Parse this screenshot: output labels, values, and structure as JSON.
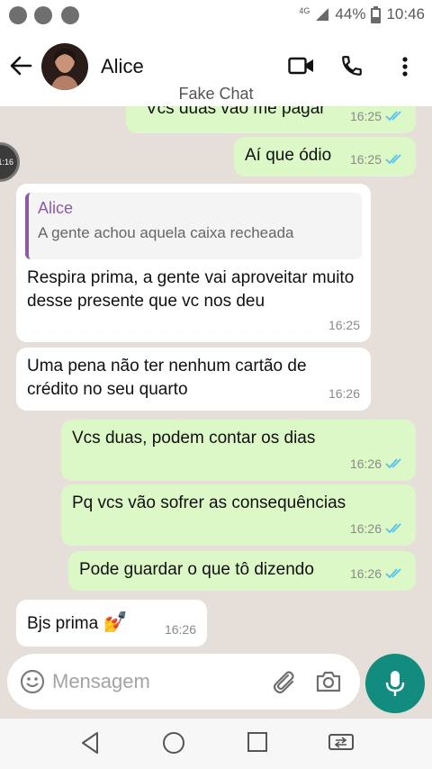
{
  "status_bar": {
    "battery": "44%",
    "time": "10:46",
    "network": "4G"
  },
  "header": {
    "contact_name": "Alice",
    "watermark": "Fake Chat"
  },
  "timer_badge": "1:16",
  "messages": [
    {
      "direction": "out",
      "text": "Vcs duas vão me pagar",
      "time": "16:25",
      "read": true
    },
    {
      "direction": "out",
      "text": "Aí que ódio",
      "time": "16:25",
      "read": true
    },
    {
      "direction": "in",
      "quote_author": "Alice",
      "quote_text": "A gente achou aquela caixa recheada",
      "text": "Respira prima, a gente vai aproveitar muito desse presente que vc nos deu",
      "time": "16:25"
    },
    {
      "direction": "in",
      "text": "Uma pena não ter nenhum cartão de crédito no seu quarto",
      "time": "16:26"
    },
    {
      "direction": "out",
      "text": "Vcs duas, podem contar os dias",
      "time": "16:26",
      "read": true
    },
    {
      "direction": "out",
      "text": "Pq vcs vão sofrer as consequências",
      "time": "16:26",
      "read": true
    },
    {
      "direction": "out",
      "text": "Pode guardar o que tô dizendo",
      "time": "16:26",
      "read": true
    },
    {
      "direction": "in",
      "text": "Bjs prima",
      "emoji": "💅",
      "time": "16:26"
    }
  ],
  "composer": {
    "placeholder": "Mensagem"
  },
  "colors": {
    "outgoing": "#dcf8c6",
    "incoming": "#ffffff",
    "chat_bg": "#e6ded8",
    "accent": "#128c7e",
    "tick_blue": "#4fc3f7",
    "quote_bar": "#8e5aa8"
  },
  "icons": [
    "back-arrow-icon",
    "video-call-icon",
    "phone-icon",
    "more-vert-icon",
    "emoji-icon",
    "attach-icon",
    "camera-icon",
    "mic-icon",
    "nav-back-icon",
    "nav-home-icon",
    "nav-recents-icon",
    "nav-switch-icon"
  ]
}
